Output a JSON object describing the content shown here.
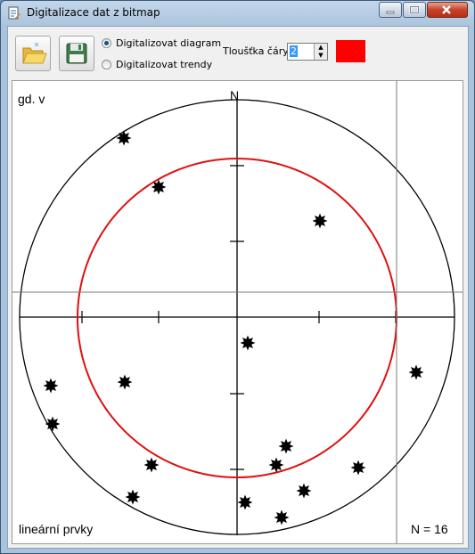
{
  "window": {
    "title": "Digitalizace dat z bitmap"
  },
  "toolbar": {
    "radio_diagram": "Digitalizovat diagram",
    "radio_trends": "Digitalizovat trendy",
    "radio_selected": "diagram",
    "thickness_label": "Tloušťka čáry",
    "thickness_value": "2",
    "line_color": "#ff0000"
  },
  "diagram": {
    "north_label": "N",
    "top_left_label": "gd. v",
    "bottom_left_label": "lineární prvky",
    "count_label": "N = 16"
  },
  "chart_data": {
    "type": "scatter",
    "points_count": 16
  }
}
